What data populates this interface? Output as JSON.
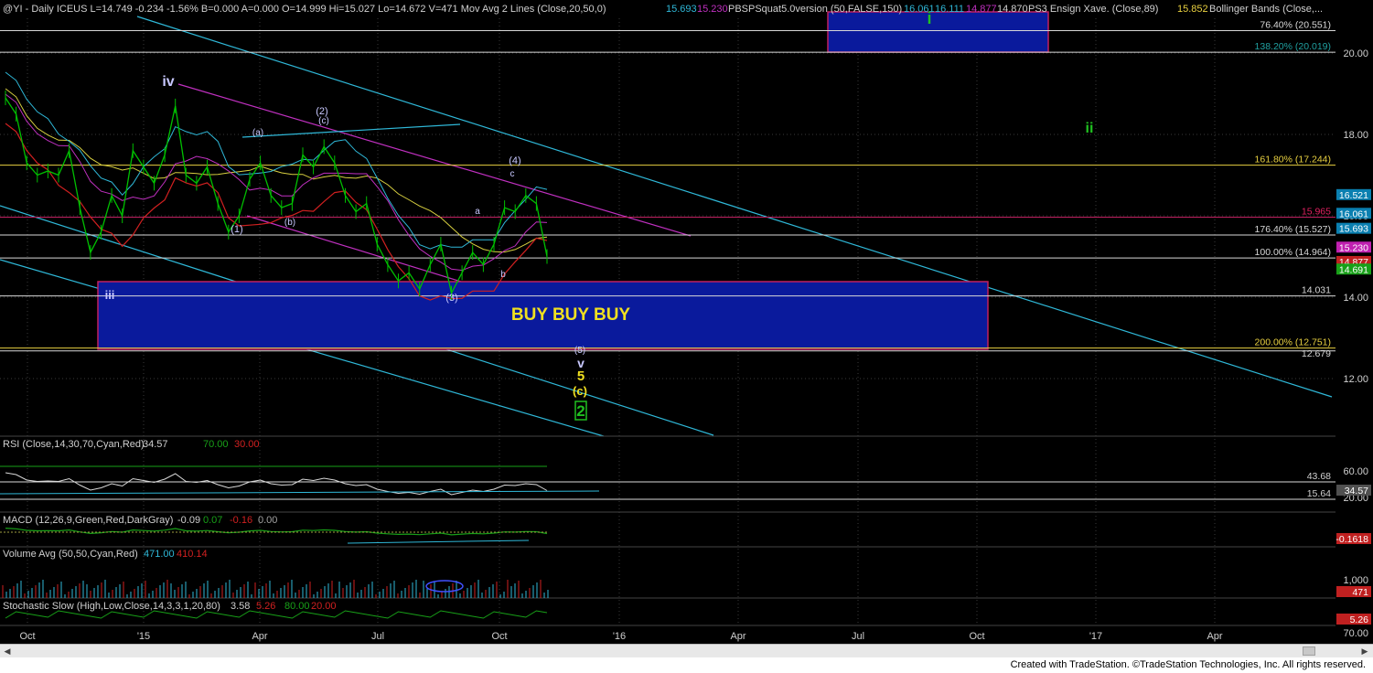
{
  "header": {
    "line": "@YI - Daily  ICEUS  L=14.749  -0.234  -1.56%  B=0.000  A=0.000  O=14.999  Hi=15.027  Lo=14.672  V=471  Mov Avg 2 Lines (Close,20,50,0)",
    "ma_values": [
      "15.693",
      "15.230"
    ],
    "pbs": "PBSPSquat5.0version (50,FALSE,150)",
    "pbs_values": [
      "16.061",
      "16.111",
      "14.877",
      "14.870"
    ],
    "ensign": "PS3 Ensign Xave. (Close,89)",
    "ensign_value": "15.852",
    "bollinger": "Bollinger Bands (Close,..."
  },
  "colors": {
    "background": "#000000",
    "grid": "#505050",
    "price": "#00c000",
    "channel_cyan": "#2fb8d8",
    "channel_magenta": "#c030c0",
    "buy_box": "#0a1a9c",
    "box_border": "#c02060",
    "fib_label": "#e8d040",
    "wave_green": "#20c020",
    "wave_yellow": "#f0e020"
  },
  "chart_data": [
    {
      "type": "line",
      "title": "",
      "x_ticks": [
        "Oct",
        "'15",
        "Apr",
        "Jul",
        "Oct",
        "'16",
        "Apr",
        "Jul",
        "Oct",
        "'17",
        "Apr"
      ],
      "y_ticks": [
        12.0,
        14.0,
        16.0,
        18.0,
        20.0
      ],
      "ylim": [
        10.6,
        21.0
      ],
      "series": [
        {
          "values": [
            18.9,
            18.5,
            17.3,
            17.0,
            17.1,
            17.0,
            17.6,
            16.2,
            15.1,
            15.6,
            16.5,
            16.0,
            17.6,
            17.2,
            16.8,
            17.5,
            18.7,
            17.0,
            16.8,
            17.2,
            16.3,
            15.6,
            16.0,
            16.9,
            17.3,
            16.5,
            16.2,
            16.3,
            17.5,
            17.2,
            17.7,
            17.3,
            16.5,
            16.1,
            16.3,
            15.3,
            14.8,
            14.4,
            14.6,
            14.2,
            14.8,
            15.3,
            14.1,
            14.6,
            15.1,
            14.8,
            15.3,
            16.2,
            16.1,
            16.5,
            16.3,
            15.0
          ]
        }
      ],
      "indicator_values": {
        "mov_avg_20": 15.693,
        "mov_avg_50": 15.23,
        "pbs": 16.061,
        "ensign": 15.852
      },
      "price_levels": [
        {
          "label": "76.40% (20.551)",
          "value": 20.551
        },
        {
          "label": "138.20% (20.019)",
          "value": 20.019
        },
        {
          "label": "161.80% (17.244)",
          "value": 17.244
        },
        {
          "label": "15.965",
          "value": 15.965
        },
        {
          "label": "176.40% (15.527)",
          "value": 15.527
        },
        {
          "label": "100.00% (14.964)",
          "value": 14.964
        },
        {
          "label": "14.031",
          "value": 14.031
        },
        {
          "label": "200.00% (12.751)",
          "value": 12.751
        },
        {
          "label": "12.679",
          "value": 12.679
        }
      ],
      "right_tags": [
        {
          "label": "16.521",
          "value": 16.521,
          "color": "#0a7fb0"
        },
        {
          "label": "16.061",
          "value": 16.061,
          "color": "#0a7fb0"
        },
        {
          "label": "15.693",
          "value": 15.693,
          "color": "#0a7fb0"
        },
        {
          "label": "15.230",
          "value": 15.23,
          "color": "#c020b0"
        },
        {
          "label": "14.877",
          "value": 14.877,
          "color": "#c02020"
        },
        {
          "label": "14.691",
          "value": 14.691,
          "color": "#18a018"
        }
      ],
      "annotations": {
        "buy_zone_label": "BUY BUY BUY",
        "waves": [
          {
            "label": "iv",
            "color": "#c8c8ff"
          },
          {
            "label": "iii",
            "color": "#c8c8ff"
          },
          {
            "label": "(2)",
            "color": "#c8c8ff"
          },
          {
            "label": "(c)",
            "color": "#c8c8ff"
          },
          {
            "label": "(a)",
            "color": "#c8c8ff"
          },
          {
            "label": "(1)",
            "color": "#c8c8ff"
          },
          {
            "label": "(b)",
            "color": "#c8c8ff"
          },
          {
            "label": "(3)",
            "color": "#c8c8ff"
          },
          {
            "label": "a",
            "color": "#c8c8ff"
          },
          {
            "label": "b",
            "color": "#c8c8ff"
          },
          {
            "label": "(4)",
            "color": "#c8c8ff"
          },
          {
            "label": "c",
            "color": "#c8c8ff"
          },
          {
            "label": "(5)",
            "color": "#c8c8ff"
          },
          {
            "label": "v",
            "color": "#c8c8ff"
          },
          {
            "label": "5",
            "color": "#f0e020"
          },
          {
            "label": "(c)",
            "color": "#f0e020"
          },
          {
            "label": "2",
            "color": "#20c020"
          },
          {
            "label": "i",
            "color": "#20c020"
          },
          {
            "label": "ii",
            "color": "#20c020"
          }
        ]
      }
    },
    {
      "type": "line",
      "title": "RSI (Close,14,30,70,Cyan,Red)",
      "header_values": [
        "34.57",
        "70.00",
        "30.00"
      ],
      "levels": [
        {
          "label": "43.68",
          "value": 43.68
        },
        {
          "label": "15.64",
          "value": 15.64
        }
      ],
      "y_ticks": [
        "60.00",
        "20.00"
      ],
      "last_value": "34.57"
    },
    {
      "type": "line",
      "title": "MACD (12,26,9,Green,Red,DarkGray)",
      "header_values": [
        "-0.09",
        "0.07",
        "-0.16",
        "0.00"
      ],
      "last_value": "-0.1618"
    },
    {
      "type": "bar",
      "title": "Volume Avg (50,50,Cyan,Red)",
      "header_values": [
        "471.00",
        "410.14"
      ],
      "y_ticks": [
        "1,000"
      ],
      "last_value": "471"
    },
    {
      "type": "line",
      "title": "Stochastic Slow (High,Low,Close,14,3,3,1,20,80)",
      "header_values": [
        "3.58",
        "5.26",
        "80.00",
        "20.00"
      ],
      "y_ticks": [
        "70.00"
      ],
      "last_value": "5.26"
    }
  ],
  "footer": {
    "credit": "Created with TradeStation. ©TradeStation Technologies, Inc. All rights reserved."
  }
}
